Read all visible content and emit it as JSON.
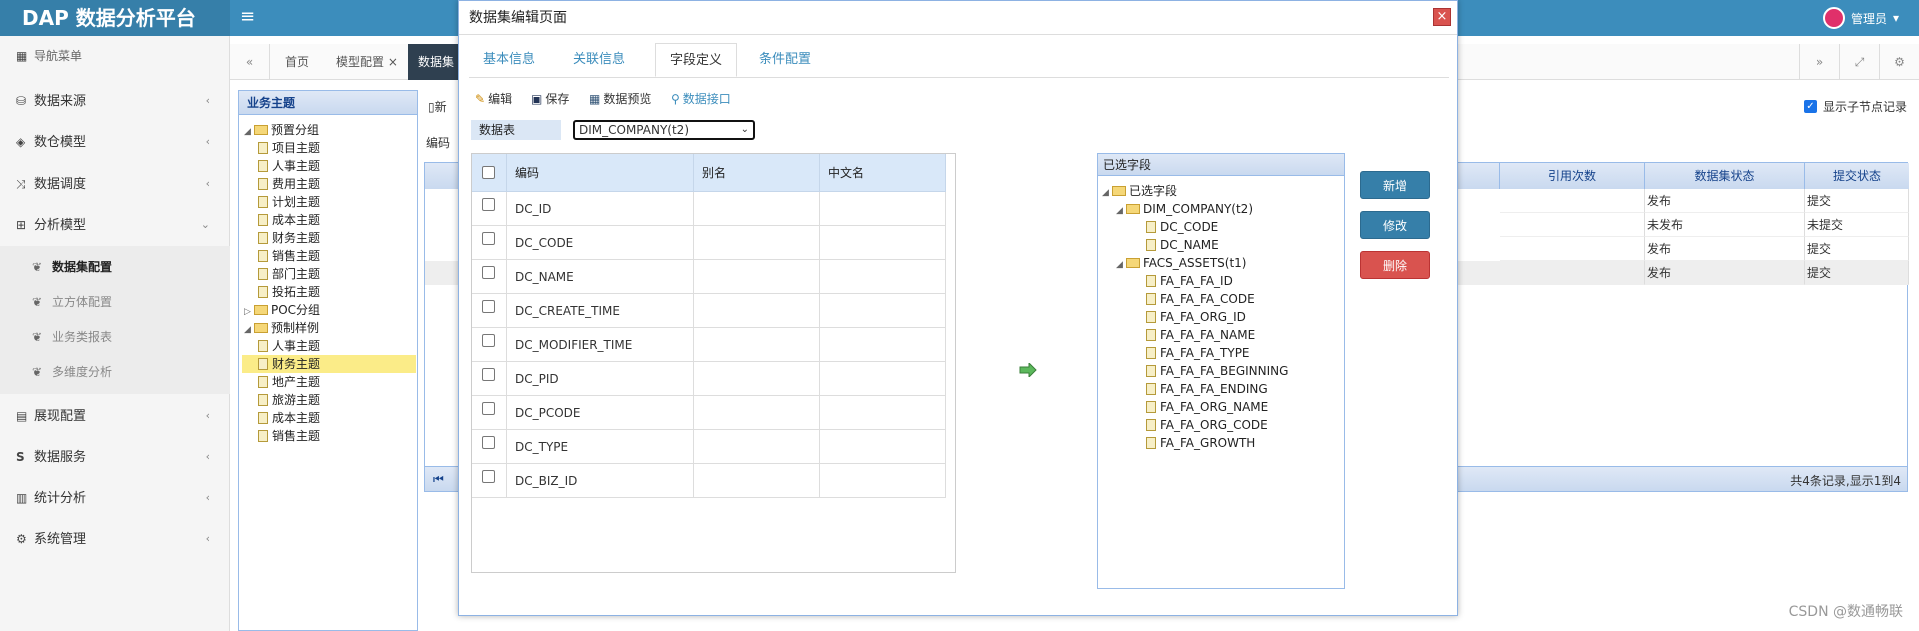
{
  "header": {
    "brand": "DAP 数据分析平台",
    "user": "管理员"
  },
  "sidebar": {
    "title": "导航菜单",
    "items": [
      {
        "label": "数据来源",
        "icon": "database-icon"
      },
      {
        "label": "数仓模型",
        "icon": "cubes-icon"
      },
      {
        "label": "数据调度",
        "icon": "shuffle-icon"
      },
      {
        "label": "分析模型",
        "icon": "sitemap-icon"
      },
      {
        "label": "展现配置",
        "icon": "film-icon"
      },
      {
        "label": "数据服务",
        "icon": "s-icon"
      },
      {
        "label": "统计分析",
        "icon": "bar-chart-icon"
      },
      {
        "label": "系统管理",
        "icon": "gear-icon"
      }
    ],
    "subitems": [
      "数据集配置",
      "立方体配置",
      "业务类报表",
      "多维度分析"
    ]
  },
  "tabs": {
    "home": "首页",
    "model": "模型配置",
    "dataset": "数据集"
  },
  "tree": {
    "title": "业务主题",
    "groups": [
      {
        "label": "预置分组",
        "children": [
          "项目主题",
          "人事主题",
          "费用主题",
          "计划主题",
          "成本主题",
          "财务主题",
          "销售主题",
          "部门主题",
          "投拓主题"
        ]
      },
      {
        "label": "POC分组",
        "children": []
      },
      {
        "label": "预制样例",
        "children": [
          "人事主题",
          "财务主题",
          "地产主题",
          "旅游主题",
          "成本主题",
          "销售主题"
        ]
      }
    ]
  },
  "background": {
    "new_btn": "新",
    "search_label": "编码",
    "show_child": "显示子节点记录",
    "columns": [
      "引用次数",
      "数据集状态",
      "提交状态"
    ],
    "rows": [
      [
        "",
        "发布",
        "提交"
      ],
      [
        "",
        "未发布",
        "未提交"
      ],
      [
        "",
        "发布",
        "提交"
      ],
      [
        "",
        "发布",
        "提交"
      ]
    ],
    "pager": "共4条记录,显示1到4"
  },
  "modal": {
    "title": "数据集编辑页面",
    "close": "×",
    "tabs": [
      "基本信息",
      "关联信息",
      "字段定义",
      "条件配置"
    ],
    "toolbar": [
      "编辑",
      "保存",
      "数据预览",
      "数据接口"
    ],
    "ds_label": "数据表",
    "ds_value": "DIM_COMPANY(t2)",
    "field_columns": [
      "编码",
      "别名",
      "中文名"
    ],
    "fields": [
      "DC_ID",
      "DC_CODE",
      "DC_NAME",
      "DC_CREATE_TIME",
      "DC_MODIFIER_TIME",
      "DC_PID",
      "DC_PCODE",
      "DC_TYPE",
      "DC_BIZ_ID"
    ],
    "selected": {
      "title": "已选字段",
      "root": "已选字段",
      "tables": [
        {
          "name": "DIM_COMPANY(t2)",
          "fields": [
            "DC_CODE",
            "DC_NAME"
          ]
        },
        {
          "name": "FACS_ASSETS(t1)",
          "fields": [
            "FA_FA_FA_ID",
            "FA_FA_FA_CODE",
            "FA_FA_ORG_ID",
            "FA_FA_FA_NAME",
            "FA_FA_FA_TYPE",
            "FA_FA_FA_BEGINNING",
            "FA_FA_FA_ENDING",
            "FA_FA_ORG_NAME",
            "FA_FA_ORG_CODE",
            "FA_FA_GROWTH"
          ]
        }
      ]
    },
    "buttons": {
      "add": "新增",
      "edit": "修改",
      "delete": "删除"
    }
  },
  "watermark": "CSDN @数通畅联",
  "colors": {
    "header": "#3c8dbc",
    "brand": "#367fa9",
    "danger": "#d9534f"
  }
}
